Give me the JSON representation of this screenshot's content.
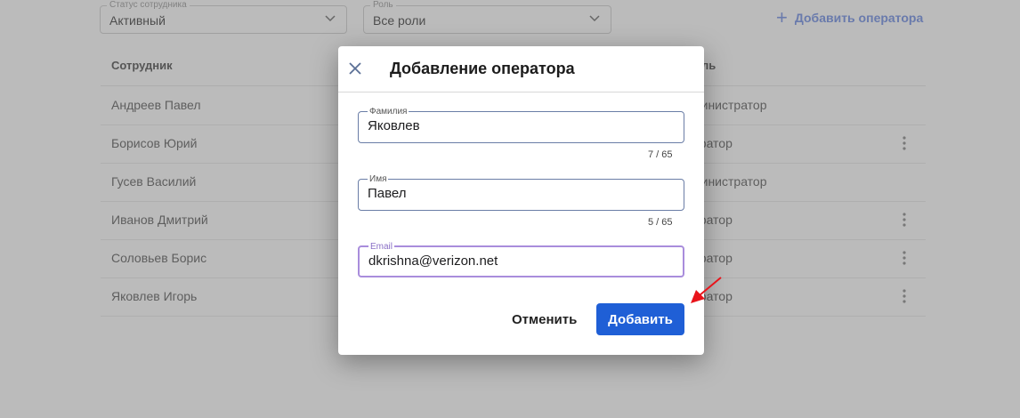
{
  "filters": {
    "status": {
      "label": "Статус сотрудника",
      "value": "Активный"
    },
    "role": {
      "label": "Роль",
      "value": "Все роли"
    },
    "add_operator_label": "Добавить оператора"
  },
  "table": {
    "col_employee": "Сотрудник",
    "col_role_fragment": "ль",
    "rows": [
      {
        "name": "Андреев Павел",
        "role_fragment": "министратор"
      },
      {
        "name": "Борисов Юрий",
        "role_fragment": "ератор"
      },
      {
        "name": "Гусев Василий",
        "role_fragment": "министратор"
      },
      {
        "name": "Иванов Дмитрий",
        "role_fragment": "ератор"
      },
      {
        "name": "Соловьев Борис",
        "role_fragment": "ератор"
      },
      {
        "name": "Яковлев Игорь",
        "role_fragment": "ератор"
      }
    ]
  },
  "modal": {
    "title": "Добавление оператора",
    "fields": {
      "last_name": {
        "label": "Фамилия",
        "value": "Яковлев",
        "counter": "7 / 65"
      },
      "first_name": {
        "label": "Имя",
        "value": "Павел",
        "counter": "5 / 65"
      },
      "email": {
        "label": "Email",
        "value": "dkrishna@verizon.net"
      }
    },
    "cancel_label": "Отменить",
    "submit_label": "Добавить"
  },
  "colors": {
    "accent": "#1f5fd6",
    "focus": "#a98ddc",
    "annotation_arrow": "#e8141b"
  }
}
